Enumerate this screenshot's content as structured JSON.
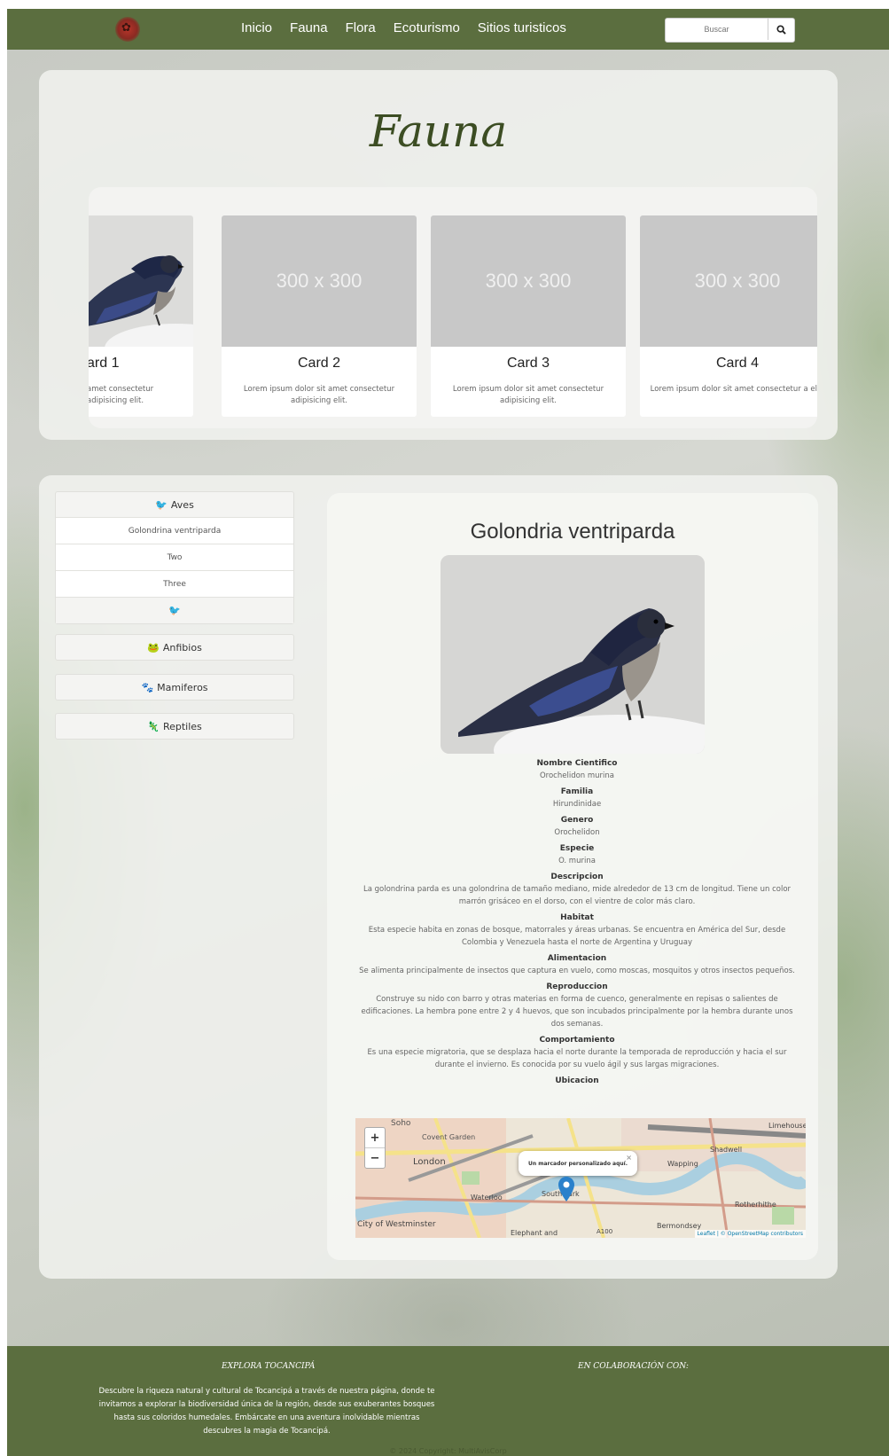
{
  "navbar": {
    "links": [
      "Inicio",
      "Fauna",
      "Flora",
      "Ecoturismo",
      "Sitios turisticos"
    ],
    "search_placeholder": "Buscar"
  },
  "hero": {
    "title": "Fauna",
    "cards": [
      {
        "title": "ard 1",
        "text": "amet consectetur adipisicing elit.",
        "image": "bird-photo"
      },
      {
        "title": "Card 2",
        "text": "Lorem ipsum dolor sit amet consectetur adipisicing elit.",
        "image": "300 x 300"
      },
      {
        "title": "Card 3",
        "text": "Lorem ipsum dolor sit amet consectetur adipisicing elit.",
        "image": "300 x 300"
      },
      {
        "title": "Card 4",
        "text": "Lorem ipsum dolor sit amet consectetur a elit.",
        "image": "300 x 300"
      }
    ]
  },
  "sidebar": {
    "aves": {
      "label": "Aves",
      "items": [
        "Golondrina ventriparda",
        "Two",
        "Three"
      ]
    },
    "anfibios": {
      "label": "Anfibios"
    },
    "mamiferos": {
      "label": "Mamiferos"
    },
    "reptiles": {
      "label": "Reptiles"
    }
  },
  "detail": {
    "title": "Golondria ventriparda",
    "facts": [
      {
        "label": "Nombre Cientifico",
        "value": "Orochelidon murina"
      },
      {
        "label": "Familia",
        "value": "Hirundinidae"
      },
      {
        "label": "Genero",
        "value": "Orochelidon"
      },
      {
        "label": "Especie",
        "value": "O. murina"
      },
      {
        "label": "Descripcion",
        "value": "La golondrina parda es una golondrina de tamaño mediano, mide alrededor de 13 cm de longitud. Tiene un color marrón grisáceo en el dorso, con el vientre de color más claro."
      },
      {
        "label": "Habitat",
        "value": "Esta especie habita en zonas de bosque, matorrales y áreas urbanas. Se encuentra en América del Sur, desde Colombia y Venezuela hasta el norte de Argentina y Uruguay"
      },
      {
        "label": "Alimentacion",
        "value": "Se alimenta principalmente de insectos que captura en vuelo, como moscas, mosquitos y otros insectos pequeños."
      },
      {
        "label": "Reproduccion",
        "value": "Construye su nido con barro y otras materias en forma de cuenco, generalmente en repisas o salientes de edificaciones. La hembra pone entre 2 y 4 huevos, que son incubados principalmente por la hembra durante unos dos semanas."
      },
      {
        "label": "Comportamiento",
        "value": "Es una especie migratoria, que se desplaza hacia el norte durante la temporada de reproducción y hacia el sur durante el invierno. Es conocida por su vuelo ágil y sus largas migraciones."
      },
      {
        "label": "Ubicacion",
        "value": ""
      }
    ],
    "map": {
      "popup": "Un marcador personalizado aquí.",
      "zoom_in": "+",
      "zoom_out": "−",
      "attribution": "Leaflet | © OpenStreetMap contributors",
      "places": [
        "Soho",
        "Covent Garden",
        "London",
        "Waterloo",
        "Southwark",
        "City of Westminster",
        "Elephant and",
        "Shadwell",
        "Wapping",
        "Limehouse",
        "Rotherhithe",
        "Bermondsey",
        "A100"
      ]
    }
  },
  "footer": {
    "explore_title": "EXPLORA TOCANCIPÁ",
    "explore_text": "Descubre la riqueza natural y cultural de Tocancipá a través de nuestra página, donde te invitamos a explorar la biodiversidad única de la región, desde sus exuberantes bosques hasta sus coloridos humedales. Embárcate en una aventura inolvidable mientras descubres la magia de Tocancipá.",
    "collab_title": "EN COLABORACIÓN CON:",
    "copyright": "© 2024 Copyright: MultiAvisCorp"
  },
  "colors": {
    "primary": "#5b6e3f",
    "title": "#3c4d23"
  }
}
